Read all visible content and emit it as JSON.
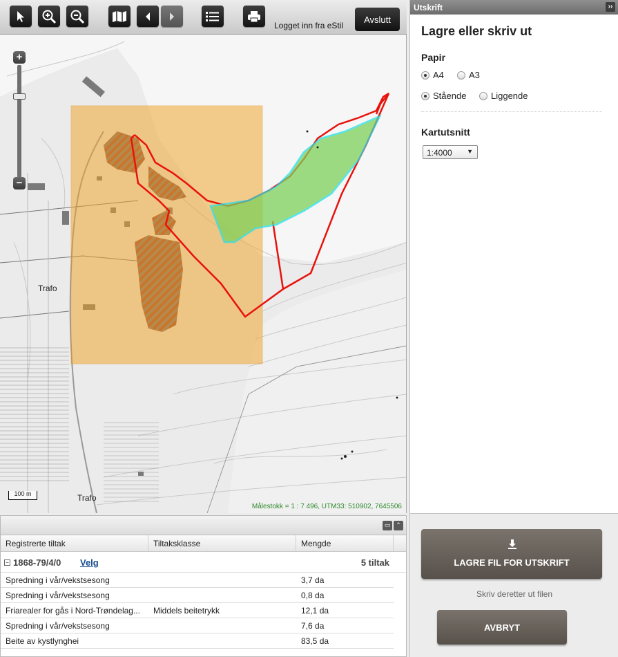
{
  "toolbar": {
    "login_text": "Logget inn fra eStil",
    "logout_label": "Avslutt",
    "icons": [
      "pointer-icon",
      "zoom-in-icon",
      "zoom-out-icon",
      "map-icon",
      "back-icon",
      "forward-icon",
      "list-icon",
      "print-icon"
    ]
  },
  "map": {
    "zoom_in": "+",
    "zoom_out": "−",
    "scalebar_label": "100 m",
    "scale_info": "Målestokk = 1 : 7 496, UTM33: 510902, 7645506",
    "labels": {
      "trafo_1": "Trafo",
      "trafo_2": "Trafo"
    },
    "colors": {
      "print_area": "#f0a020",
      "boundary": "#e8120c",
      "water_area": "#7fd15a",
      "water_outline": "#22e0e8",
      "hatch": "#c7722a"
    }
  },
  "table": {
    "columns": [
      "Registrerte tiltak",
      "Tiltaksklasse",
      "Mengde"
    ],
    "group": {
      "toggle": "−",
      "title": "1868-79/4/0",
      "link": "Velg",
      "count": "5 tiltak"
    },
    "rows": [
      {
        "tiltak": "Spredning i vår/vekstsesong",
        "klasse": "",
        "mengde": "3,7 da"
      },
      {
        "tiltak": "Spredning i vår/vekstsesong",
        "klasse": "",
        "mengde": "0,8 da"
      },
      {
        "tiltak": "Friarealer for gås i Nord-Trøndelag...",
        "klasse": "Middels beitetrykk",
        "mengde": "12,1 da"
      },
      {
        "tiltak": "Spredning i vår/vekstsesong",
        "klasse": "",
        "mengde": "7,6 da"
      },
      {
        "tiltak": "Beite av kystlynghei",
        "klasse": "",
        "mengde": "83,5 da"
      }
    ]
  },
  "panel": {
    "title": "Utskrift",
    "collapse": "››",
    "heading": "Lagre eller skriv ut",
    "paper_label": "Papir",
    "paper_sizes": [
      {
        "label": "A4",
        "selected": true
      },
      {
        "label": "A3",
        "selected": false
      }
    ],
    "orientations": [
      {
        "label": "Stående",
        "selected": true
      },
      {
        "label": "Liggende",
        "selected": false
      }
    ],
    "scale_label": "Kartutsnitt",
    "scale_value": "1:4000",
    "save_button": "LAGRE FIL FOR UTSKRIFT",
    "hint": "Skriv deretter ut filen",
    "cancel_button": "AVBRYT"
  }
}
